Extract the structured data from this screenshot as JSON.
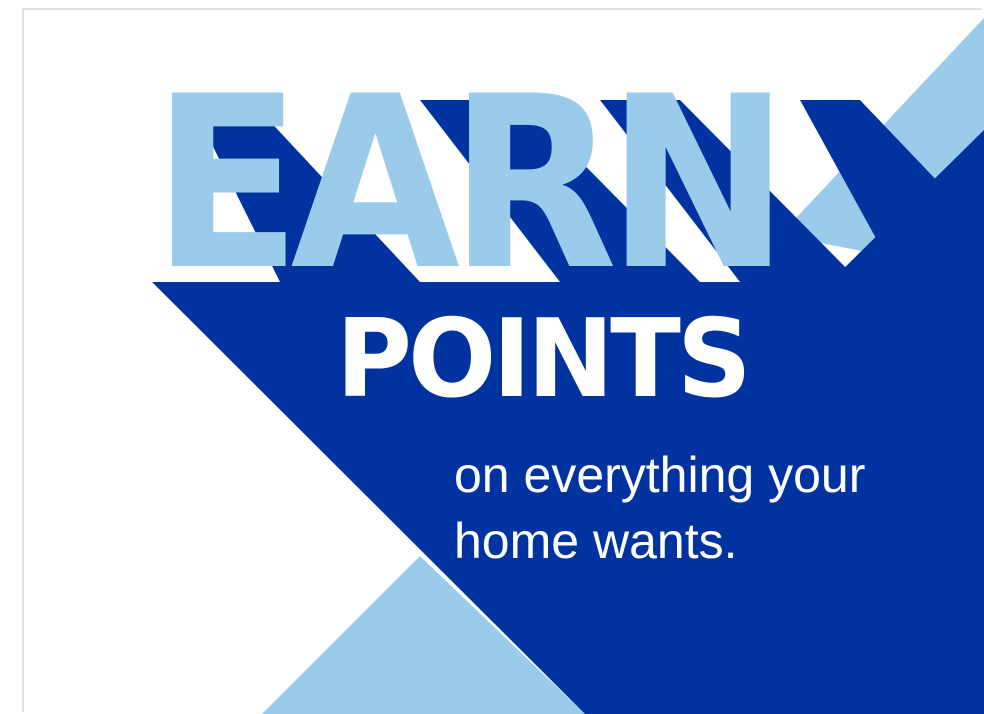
{
  "promo": {
    "headline": "EARN",
    "subheadline": "POINTS",
    "tagline_line1": "on everything your",
    "tagline_line2": "home wants."
  },
  "colors": {
    "background": "#ffffff",
    "light_blue": "#9acbea",
    "dark_blue": "#0033a0",
    "text_white": "#ffffff"
  }
}
